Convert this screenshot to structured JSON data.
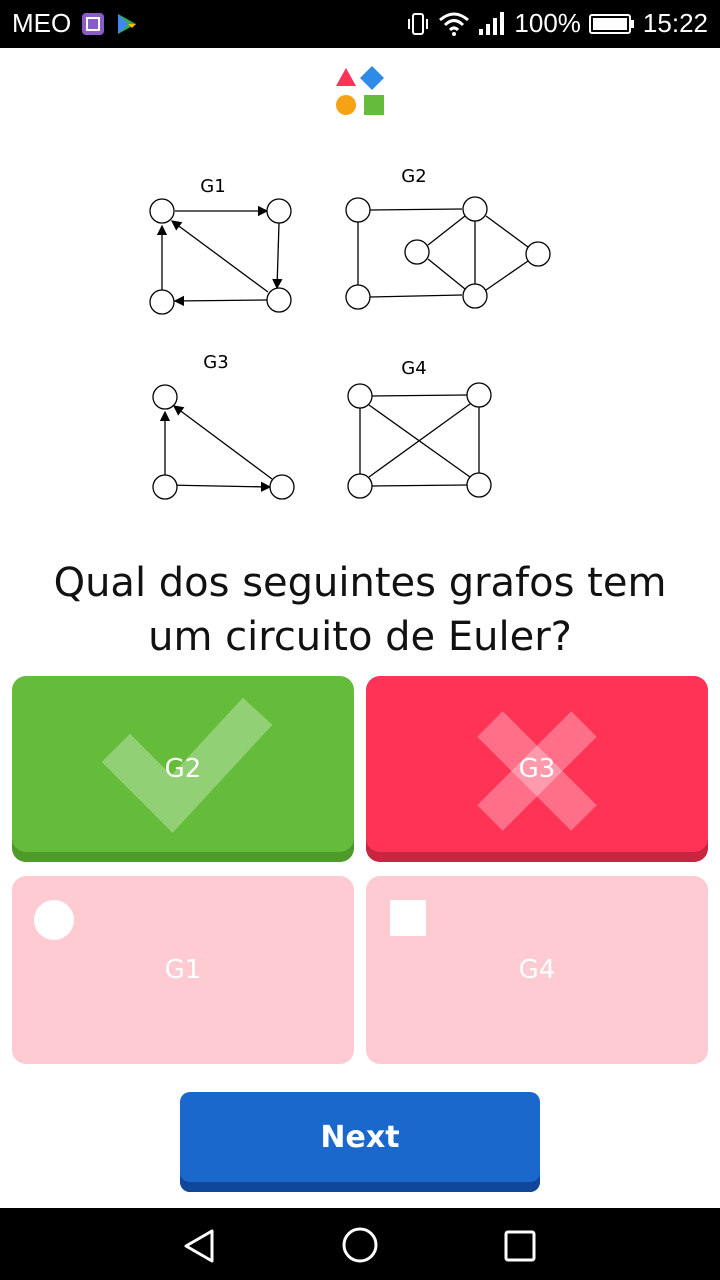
{
  "status_bar": {
    "carrier": "MEO",
    "battery": "100%",
    "time": "15:22"
  },
  "quiz": {
    "question_line1": "Qual dos seguintes grafos tem",
    "question_line2": "um circuito de Euler?",
    "graph_labels": [
      "G1",
      "G2",
      "G3",
      "G4"
    ],
    "answers": [
      {
        "label": "G2",
        "state": "correct",
        "color": "#64bc3a"
      },
      {
        "label": "G3",
        "state": "wrong",
        "color": "#ff3355"
      },
      {
        "label": "G1",
        "state": "unselected",
        "color": "#fecbd3"
      },
      {
        "label": "G4",
        "state": "unselected",
        "color": "#fecbd3"
      }
    ],
    "next_label": "Next"
  }
}
